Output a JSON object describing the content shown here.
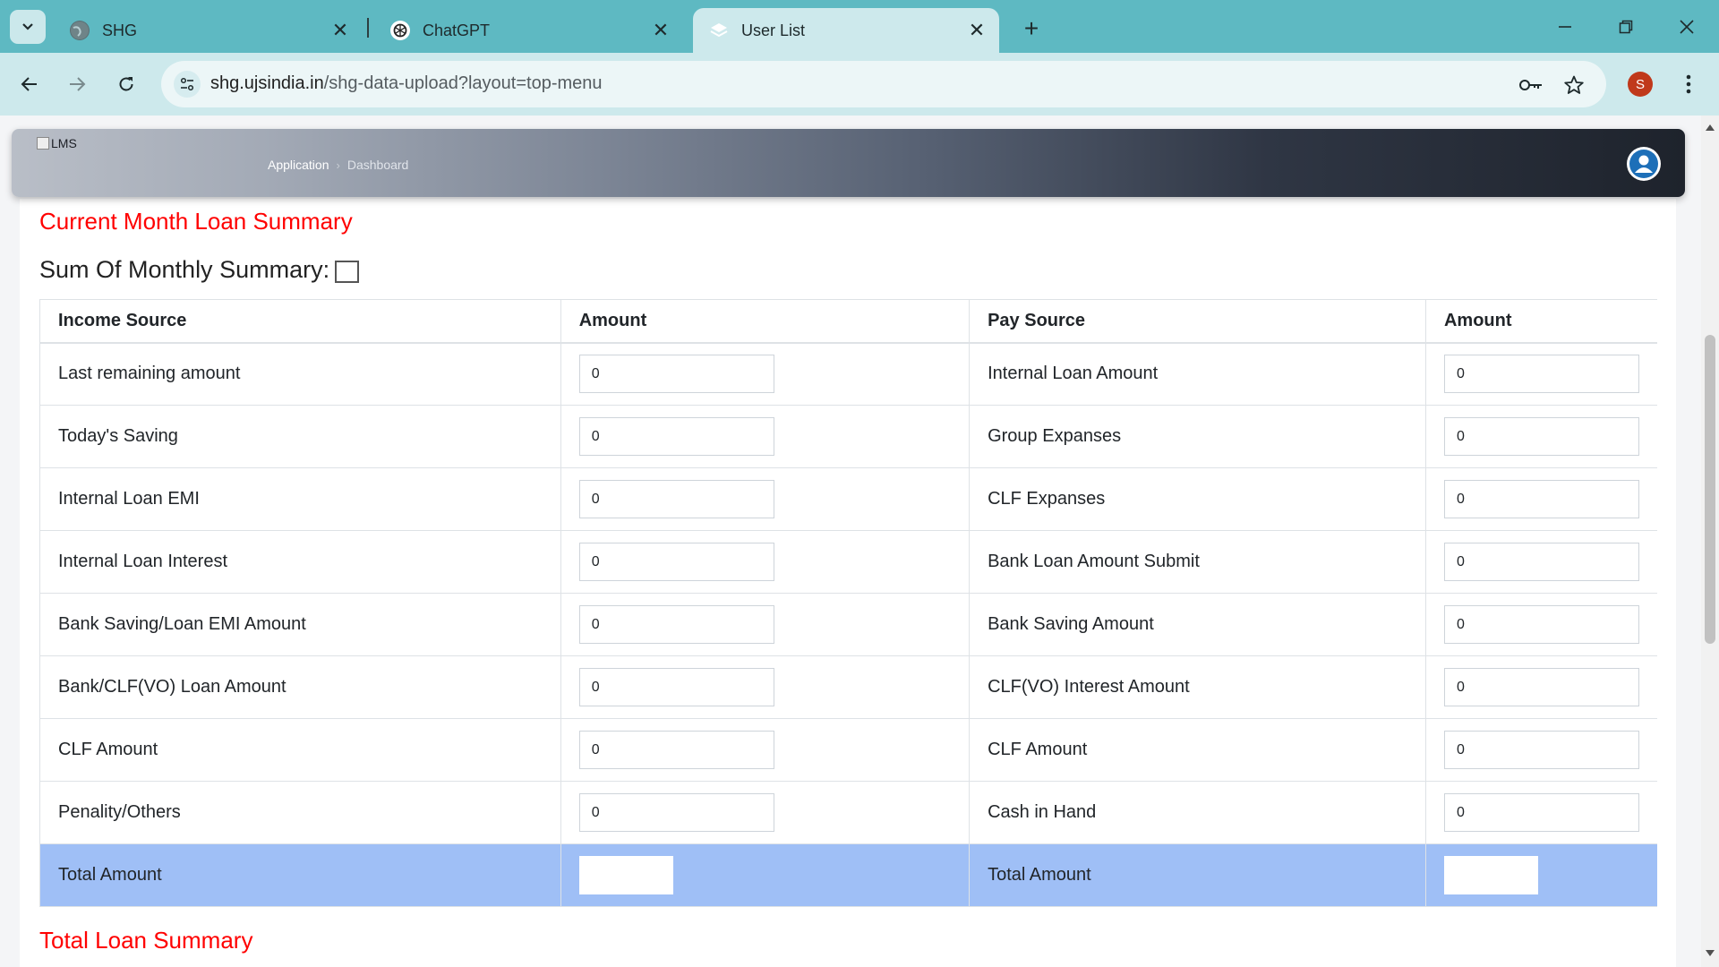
{
  "browser": {
    "tabs": [
      {
        "title": "SHG",
        "icon": "globe-icon"
      },
      {
        "title": "ChatGPT",
        "icon": "chatgpt-icon"
      },
      {
        "title": "User List",
        "icon": "layers-icon",
        "active": true
      }
    ],
    "url_domain": "shg.ujsindia.in",
    "url_path": "/shg-data-upload?layout=top-menu",
    "profile_initial": "S"
  },
  "app": {
    "logo_alt": "LMS",
    "breadcrumb": [
      "Application",
      "Dashboard"
    ]
  },
  "summary": {
    "title": "Current Month Loan Summary",
    "sum_label": "Sum Of Monthly Summary:",
    "sum_checked": false,
    "headers": [
      "Income Source",
      "Amount",
      "Pay Source",
      "Amount"
    ],
    "rows": [
      {
        "income": "Last remaining amount",
        "income_amount": "0",
        "pay": "Internal Loan Amount",
        "pay_amount": "0"
      },
      {
        "income": "Today's Saving",
        "income_amount": "0",
        "pay": "Group Expanses",
        "pay_amount": "0"
      },
      {
        "income": "Internal Loan EMI",
        "income_amount": "0",
        "pay": "CLF Expanses",
        "pay_amount": "0"
      },
      {
        "income": "Internal Loan Interest",
        "income_amount": "0",
        "pay": "Bank Loan Amount Submit",
        "pay_amount": "0"
      },
      {
        "income": "Bank Saving/Loan EMI Amount",
        "income_amount": "0",
        "pay": "Bank Saving Amount",
        "pay_amount": "0"
      },
      {
        "income": "Bank/CLF(VO) Loan Amount",
        "income_amount": "0",
        "pay": "CLF(VO) Interest Amount",
        "pay_amount": "0"
      },
      {
        "income": "CLF Amount",
        "income_amount": "0",
        "pay": "CLF Amount",
        "pay_amount": "0"
      },
      {
        "income": "Penality/Others",
        "income_amount": "0",
        "pay": "Cash in Hand",
        "pay_amount": "0"
      }
    ],
    "total_income_label": "Total Amount",
    "total_income_value": "",
    "total_pay_label": "Total Amount",
    "total_pay_value": ""
  },
  "next_section_title": "Total Loan Summary",
  "colors": {
    "tabbar": "#5eb9c2",
    "toolbar": "#cde9ec",
    "section_title": "#ff0000",
    "total_row": "#9fbff6"
  }
}
